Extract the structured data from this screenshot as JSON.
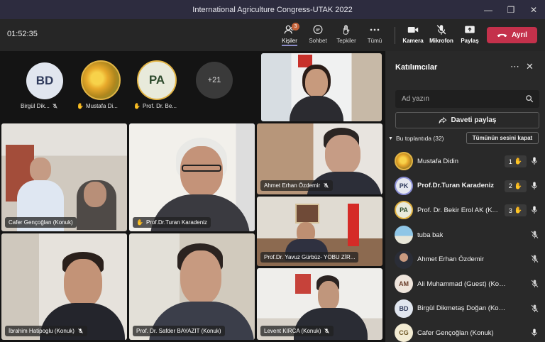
{
  "window": {
    "title": "International Agriculture Congress-UTAK 2022"
  },
  "toolbar": {
    "timer": "01:52:35",
    "people_label": "Kişiler",
    "people_badge": "3",
    "chat_label": "Sohbet",
    "reactions_label": "Tepkiler",
    "more_label": "Tümü",
    "camera_label": "Kamera",
    "mic_label": "Mikrofon",
    "share_label": "Paylaş",
    "leave_label": "Ayrıl",
    "leave_color": "#c4314b"
  },
  "strip": [
    {
      "initials": "BD",
      "name": "Birgül Dik...",
      "status": "muted"
    },
    {
      "initials": "",
      "name": "Mustafa Di...",
      "status": "hand"
    },
    {
      "initials": "PA",
      "name": "Prof. Dr. Be...",
      "status": "hand"
    },
    {
      "initials": "",
      "label": "+21"
    }
  ],
  "tiles": [
    {
      "name": "Cafer Gençoğlan (Konuk)",
      "status": "none"
    },
    {
      "name": "Prof.Dr.Turan Karadeniz",
      "status": "hand",
      "speaking": true
    },
    {
      "name": "Ahmet Erhan Özdemir",
      "status": "muted"
    },
    {
      "name": "Prof.Dr. Yavuz Gürbüz- YOBU ZİR...",
      "status": "none"
    },
    {
      "name": "İbrahim Hatipoglu (Konuk)",
      "status": "muted"
    },
    {
      "name": "Prof. Dr. Safder BAYAZIT (Konuk)",
      "status": "none"
    },
    {
      "name": "Levent KIRCA (Konuk)",
      "status": "muted"
    }
  ],
  "sidebar": {
    "title": "Katılımcılar",
    "search_placeholder": "Ad yazın",
    "share_invite": "Daveti paylaş",
    "in_meeting": "Bu toplantıda (32)",
    "mute_all": "Tümünün sesini kapat",
    "participants": [
      {
        "name": "Mustafa Didin",
        "initials": "",
        "hand": "1",
        "mic": "on",
        "avatar": "photo-tulip"
      },
      {
        "name": "Prof.Dr.Turan Karadeniz",
        "initials": "PK",
        "hand": "2",
        "mic": "on",
        "bold": true
      },
      {
        "name": "Prof. Dr. Bekir Erol AK (K...",
        "initials": "PA",
        "hand": "3",
        "mic": "on"
      },
      {
        "name": "tuba bak",
        "initials": "",
        "mic": "off",
        "avatar": "photo-sky"
      },
      {
        "name": "Ahmet Erhan Özdemir",
        "initials": "",
        "mic": "off",
        "avatar": "photo-man"
      },
      {
        "name": "Ali Muhammad (Guest) (Konuk)",
        "initials": "AM",
        "mic": "off"
      },
      {
        "name": "Birgül Dikmetaş Doğan (Konuk)",
        "initials": "BD",
        "mic": "off"
      },
      {
        "name": "Cafer Gençoğlan (Konuk)",
        "initials": "CG",
        "mic": "on"
      }
    ]
  }
}
